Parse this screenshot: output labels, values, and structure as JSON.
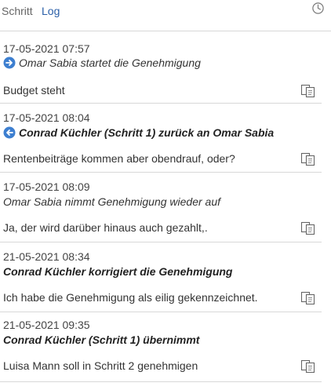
{
  "tabs": {
    "schritt": "Schritt",
    "log": "Log"
  },
  "icons": {
    "history": "clock-icon",
    "copy": "copy-icon",
    "forward": "arrow-right-icon",
    "back": "arrow-left-icon"
  },
  "colors": {
    "accent": "#2a5fa8",
    "arrow_fill": "#3d7fd0",
    "divider": "#d8d8d8"
  },
  "entries": [
    {
      "timestamp": "17-05-2021 07:57",
      "action": "Omar Sabia startet die Genehmigung",
      "comment": "Budget steht"
    },
    {
      "timestamp": "17-05-2021 08:04",
      "action": "Conrad Küchler (Schritt 1) zurück an Omar Sabia",
      "comment": "Rentenbeiträge kommen aber obendrauf, oder?"
    },
    {
      "timestamp": "17-05-2021 08:09",
      "action": "Omar Sabia nimmt Genehmigung wieder auf",
      "comment": "Ja, der wird darüber hinaus auch gezahlt,."
    },
    {
      "timestamp": "21-05-2021 08:34",
      "action": "Conrad Küchler korrigiert die Genehmigung",
      "comment": "Ich habe die Genehmigung als eilig gekennzeichnet."
    },
    {
      "timestamp": "21-05-2021 09:35",
      "action": "Conrad Küchler (Schritt 1) übernimmt",
      "comment": "Luisa Mann soll in Schritt 2 genehmigen"
    }
  ]
}
